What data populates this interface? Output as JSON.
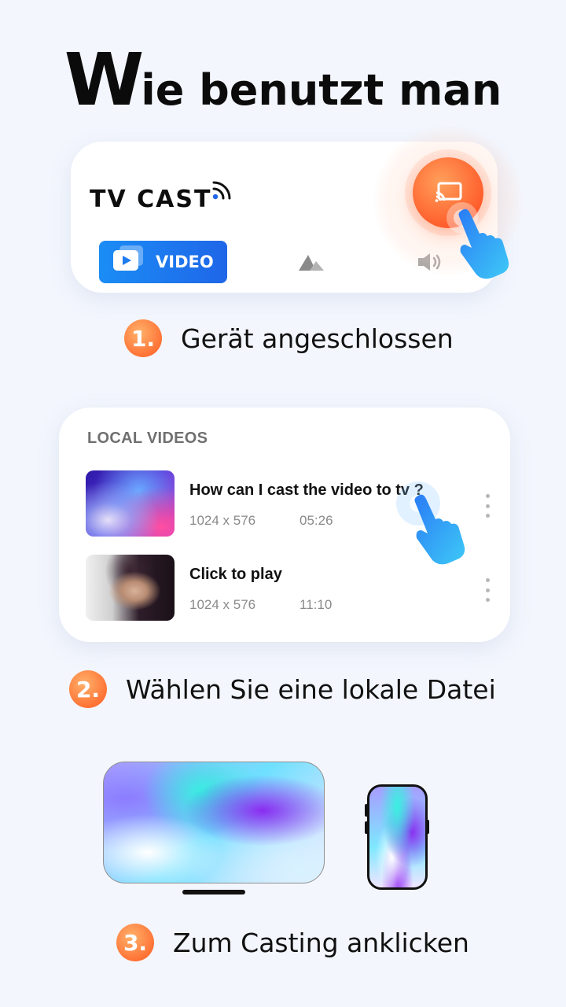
{
  "headline": {
    "first_letter": "W",
    "rest": "ie benutzt man"
  },
  "app_card": {
    "brand": "TV CAST",
    "tabs": [
      {
        "label": "VIDEO",
        "icon": "play-icon",
        "active": true
      },
      {
        "label": "",
        "icon": "image-icon",
        "active": false
      },
      {
        "label": "",
        "icon": "speaker-icon",
        "active": false
      }
    ],
    "cast_button_icon": "cast-icon"
  },
  "steps": [
    {
      "number": "1.",
      "text": "Gerät angeschlossen"
    },
    {
      "number": "2.",
      "text": "Wählen Sie eine lokale Datei"
    },
    {
      "number": "3.",
      "text": "Zum Casting anklicken"
    }
  ],
  "local_videos": {
    "title": "LOCAL VIDEOS",
    "items": [
      {
        "title": "How can I cast the video to tv ?",
        "resolution": "1024 x 576",
        "duration": "05:26"
      },
      {
        "title": "Click to play",
        "resolution": "1024 x 576",
        "duration": "11:10"
      }
    ]
  },
  "colors": {
    "background": "#f3f6fd",
    "accent_orange": "#ff6a2e",
    "accent_blue": "#1f66e8"
  }
}
